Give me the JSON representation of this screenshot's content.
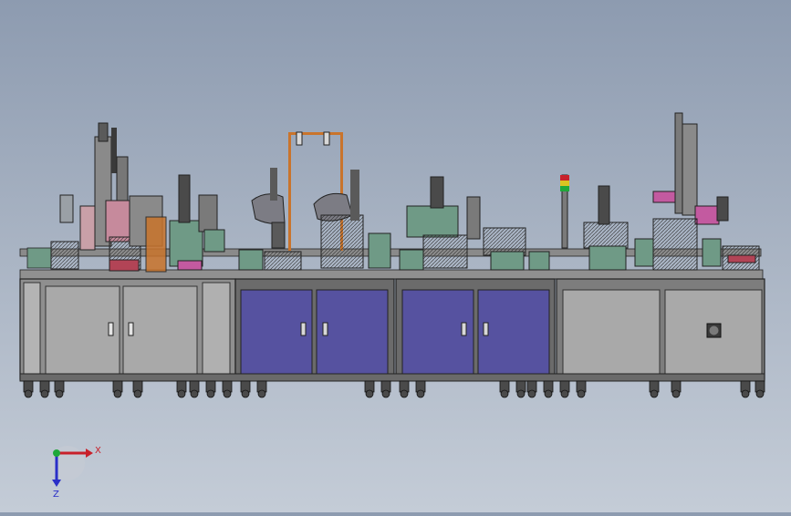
{
  "scene": {
    "colors": {
      "background_top": "#8d9bb0",
      "background_bottom": "#c4ccd7",
      "cabinet_gray": "#a7a7a7",
      "cabinet_blue": "#5652a0",
      "frame": "#3a3a3a",
      "machine_green": "#6f9a86",
      "accent_magenta": "#c35aa0",
      "accent_orange": "#c9742c",
      "robot_gray": "#7c7c84"
    },
    "modules": [
      {
        "name": "module-1",
        "door_color": "cabinet_gray"
      },
      {
        "name": "module-2",
        "door_color": "cabinet_blue"
      },
      {
        "name": "module-3",
        "door_color": "cabinet_blue"
      },
      {
        "name": "module-4",
        "door_color": "cabinet_gray"
      }
    ]
  },
  "triad": {
    "x_label": "X",
    "z_label": "Z",
    "x_color": "#c8202a",
    "z_color": "#2a2fc8",
    "y_color": "#1fa83a"
  }
}
